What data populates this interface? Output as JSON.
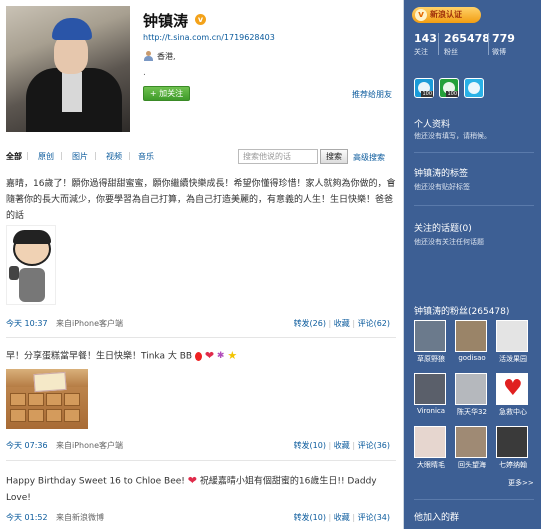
{
  "profile": {
    "name": "钟镇涛",
    "verified_mark": "v",
    "url": "http://t.sina.com.cn/1719628403",
    "location": "香港,",
    "extra": ".",
    "follow_button": "+ 加关注",
    "recommend": "推荐给朋友"
  },
  "tabs": [
    "全部",
    "原创",
    "图片",
    "视频",
    "音乐"
  ],
  "search": {
    "placeholder": "搜索他说的话",
    "button": "搜索",
    "advanced": "高级搜索"
  },
  "posts": [
    {
      "text": "嘉晴，16歲了！願你過得甜甜蜜蜜，願你繼續快樂成長！希望你懂得珍惜！家人就夠為你做的，會隨著你的長大而減少，你要學習為自己打算，為自己打造美麗的，有意義的人生！生日快樂！爸爸的話",
      "time": "今天 10:37",
      "source": "来自iPhone客户端",
      "repost": "转发(26)",
      "fav": "收藏",
      "comment": "评论(62)"
    },
    {
      "text": "早！分享蛋糕當早餐！生日快樂！Tinka 大 BB",
      "time": "今天 07:36",
      "source": "来自iPhone客户端",
      "repost": "转发(10)",
      "fav": "收藏",
      "comment": "评论(36)"
    },
    {
      "text_a": "Happy Birthday Sweet 16 to Chloe Bee!",
      "text_b": "祝緩嘉晴小姐有個甜蜜的16歲生日!! Daddy Love!",
      "time": "今天 01:52",
      "source": "来自新浪微博",
      "repost": "转发(10)",
      "fav": "收藏",
      "comment": "评论(34)"
    }
  ],
  "sidebar": {
    "verify_badge": "新浪认证",
    "verify_icon": "v",
    "stats": [
      {
        "num": "143",
        "label": "关注"
      },
      {
        "num": "265478",
        "label": "粉丝"
      },
      {
        "num": "779",
        "label": "微博"
      }
    ],
    "medals": [
      {
        "color": "#1a9bd8",
        "tag": "100"
      },
      {
        "color": "#23a03a",
        "tag": "100"
      },
      {
        "color": "#2ab1e6",
        "tag": ""
      }
    ],
    "personal_title": "个人资料",
    "personal_text": "他还没有填写，请稍候。",
    "tags_title": "钟镇涛的标签",
    "tags_text": "他还没有贴好标签",
    "topics_title": "关注的话题(0)",
    "topics_text": "他还没有关注任何话题",
    "fans_title": "钟镇涛的粉丝(265478)",
    "fans": [
      {
        "name": "草原野狼",
        "color": "#6b7a8c"
      },
      {
        "name": "godisao",
        "color": "#9a8468"
      },
      {
        "name": "活泼果园",
        "color": "#e4e4e4"
      },
      {
        "name": "Vironica",
        "color": "#5a5f6a"
      },
      {
        "name": "陈天华32",
        "color": "#b5b8bd"
      },
      {
        "name": "急救中心",
        "color": "#ffffff"
      },
      {
        "name": "大眼睛毛",
        "color": "#e6d6cf"
      },
      {
        "name": "回头望海",
        "color": "#9f8a74"
      },
      {
        "name": "七婷纳翰",
        "color": "#3a3a3a"
      }
    ],
    "more": "更多>>",
    "groups_title": "他加入的群"
  }
}
